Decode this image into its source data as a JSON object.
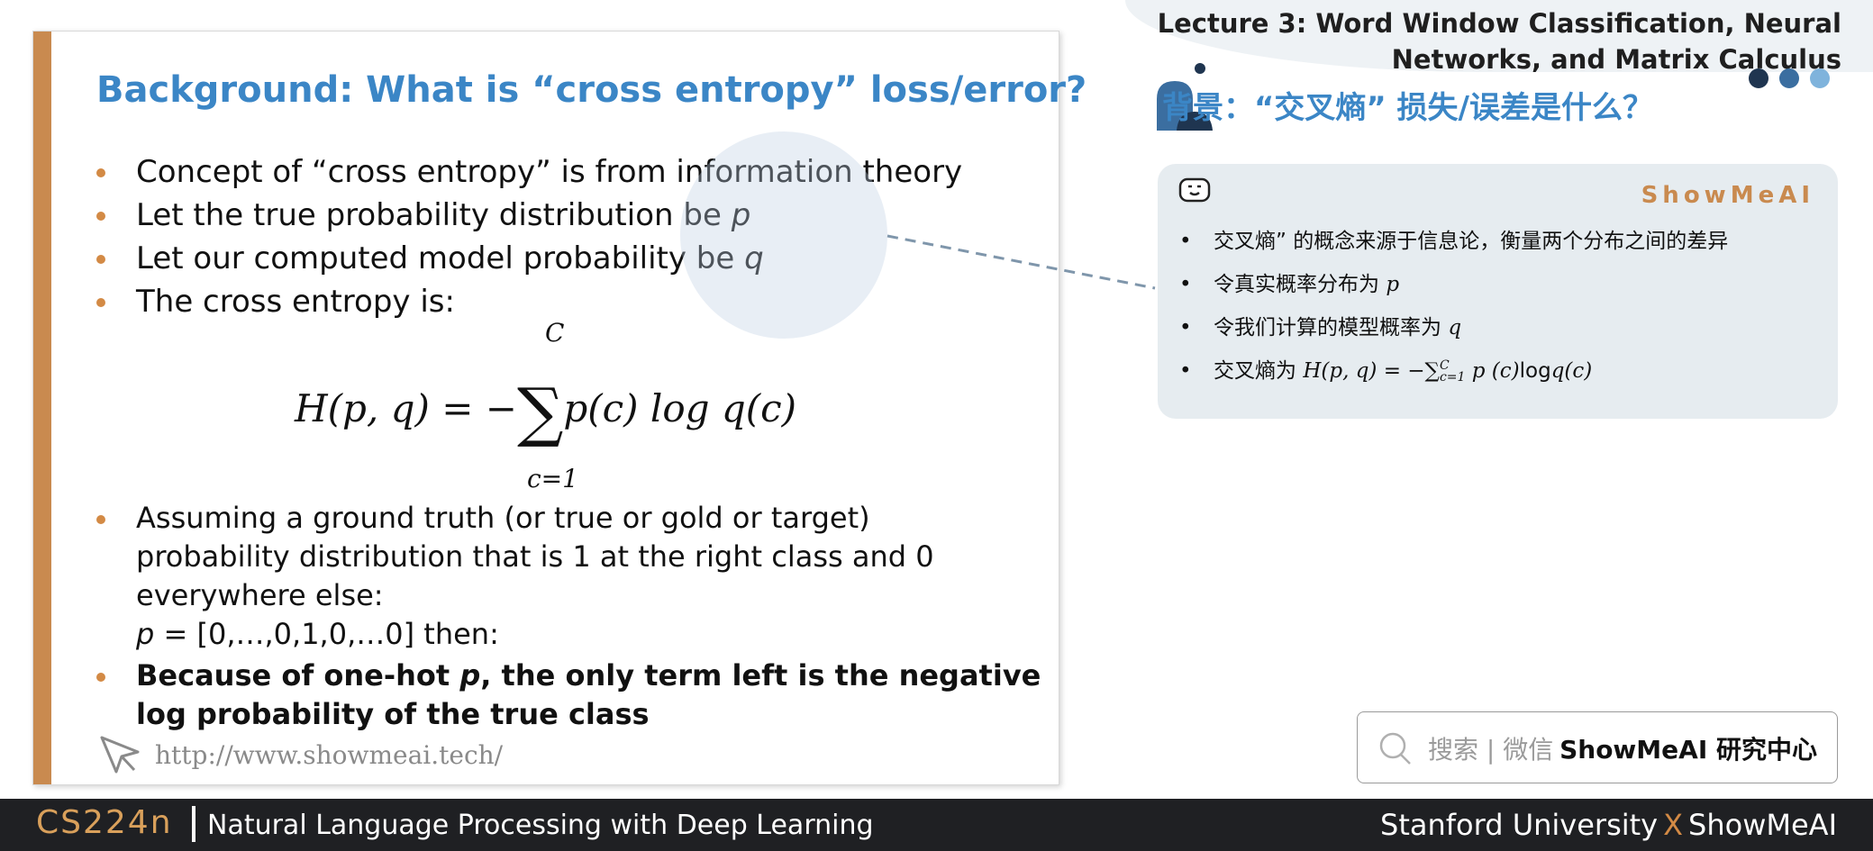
{
  "header": {
    "lecture_title_line1": "Lecture 3:  Word Window Classification, Neural",
    "lecture_title_line2": "Networks, and Matrix Calculus",
    "dot_colors": [
      "#1f3550",
      "#3b6ea0",
      "#7fb3dc"
    ]
  },
  "slide": {
    "title": "Background: What is “cross entropy” loss/error?",
    "bullets": [
      "Concept of “cross entropy” is from information theory",
      "Let the true probability distribution be ",
      "Let our computed model probability be ",
      "The cross entropy is:"
    ],
    "var_p": "p",
    "var_q": "q",
    "formula": {
      "lhs": "H(p, q) = −",
      "sum_sign": "∑",
      "sum_upper": "C",
      "sum_lower": "c=1",
      "rhs": "p(c) log q(c)"
    },
    "bullet5_line1": "Assuming a ground truth (or true or gold or target)",
    "bullet5_line2": "probability distribution that is 1 at the right class and 0",
    "bullet5_line3": "everywhere else:",
    "bullet5_line4_var": "p",
    "bullet5_line4_rest": " = [0,…,0,1,0,…0] then:",
    "bullet6_part1": "Because of one-hot ",
    "bullet6_var": "p",
    "bullet6_part2": ", the only term left is the negative",
    "bullet6_line2": "log probability of the true class",
    "url": "http://www.showmeai.tech/",
    "accent_color": "#c98a4f",
    "title_color": "#3b86c6"
  },
  "notes": {
    "title": "背景：“交叉熵” 损失/误差是什么？",
    "brand": "ShowMeAI",
    "items": [
      "交叉熵” 的概念来源于信息论，衡量两个分布之间的差异",
      "令真实概率分布为 ",
      "令我们计算的模型概率为 ",
      "交叉熵为 "
    ],
    "item2_var": "p",
    "item3_var": "q",
    "item4_formula_a": "H(p, q) = −∑",
    "item4_sup": "C",
    "item4_sub": "c=1",
    "item4_formula_b": " p (c)",
    "item4_log": "log",
    "item4_formula_c": "q(c)"
  },
  "search": {
    "placeholder": "搜索 | 微信",
    "brand": "ShowMeAI 研究中心"
  },
  "footer": {
    "course": "CS224n",
    "subtitle": "Natural Language Processing with Deep Learning",
    "right_a": "Stanford University",
    "right_x": "X",
    "right_b": "ShowMeAI"
  }
}
